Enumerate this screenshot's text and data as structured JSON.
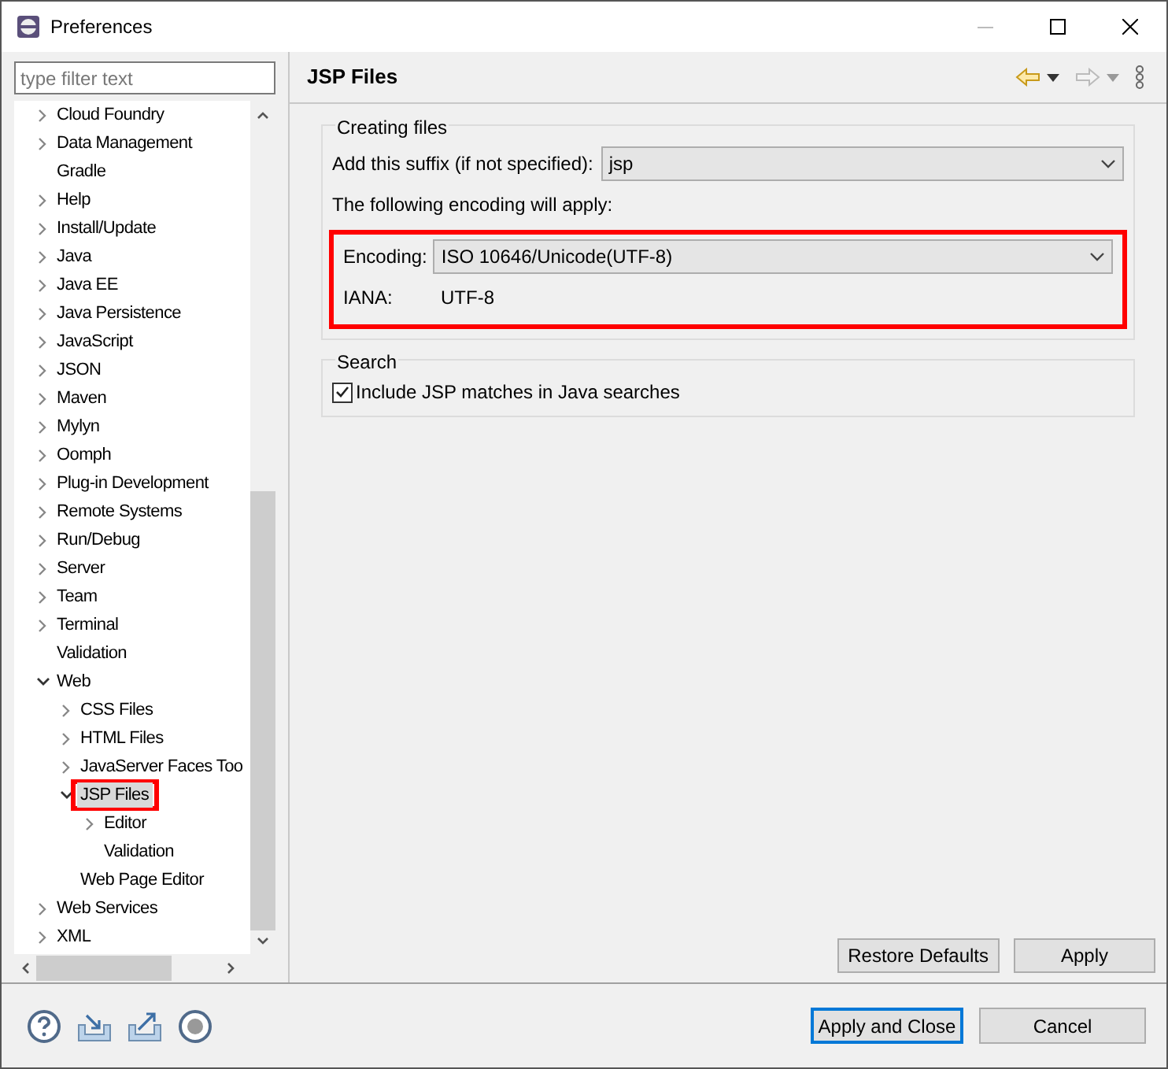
{
  "window": {
    "title": "Preferences"
  },
  "filter": {
    "placeholder": "type filter text"
  },
  "tree": [
    {
      "label": "Cloud Foundry",
      "kind": "branch",
      "expanded": false,
      "selected": false
    },
    {
      "label": "Data Management",
      "kind": "branch",
      "expanded": false,
      "selected": false
    },
    {
      "label": "Gradle",
      "kind": "leaf",
      "selected": false
    },
    {
      "label": "Help",
      "kind": "branch",
      "expanded": false,
      "selected": false
    },
    {
      "label": "Install/Update",
      "kind": "branch",
      "expanded": false,
      "selected": false
    },
    {
      "label": "Java",
      "kind": "branch",
      "expanded": false,
      "selected": false
    },
    {
      "label": "Java EE",
      "kind": "branch",
      "expanded": false,
      "selected": false
    },
    {
      "label": "Java Persistence",
      "kind": "branch",
      "expanded": false,
      "selected": false
    },
    {
      "label": "JavaScript",
      "kind": "branch",
      "expanded": false,
      "selected": false
    },
    {
      "label": "JSON",
      "kind": "branch",
      "expanded": false,
      "selected": false
    },
    {
      "label": "Maven",
      "kind": "branch",
      "expanded": false,
      "selected": false
    },
    {
      "label": "Mylyn",
      "kind": "branch",
      "expanded": false,
      "selected": false
    },
    {
      "label": "Oomph",
      "kind": "branch",
      "expanded": false,
      "selected": false
    },
    {
      "label": "Plug-in Development",
      "kind": "branch",
      "expanded": false,
      "selected": false
    },
    {
      "label": "Remote Systems",
      "kind": "branch",
      "expanded": false,
      "selected": false
    },
    {
      "label": "Run/Debug",
      "kind": "branch",
      "expanded": false,
      "selected": false
    },
    {
      "label": "Server",
      "kind": "branch",
      "expanded": false,
      "selected": false
    },
    {
      "label": "Team",
      "kind": "branch",
      "expanded": false,
      "selected": false
    },
    {
      "label": "Terminal",
      "kind": "branch",
      "expanded": false,
      "selected": false
    },
    {
      "label": "Validation",
      "kind": "leaf",
      "selected": false
    },
    {
      "label": "Web",
      "kind": "branch",
      "expanded": true,
      "selected": false,
      "children": [
        {
          "label": "CSS Files",
          "kind": "branch",
          "expanded": false,
          "selected": false
        },
        {
          "label": "HTML Files",
          "kind": "branch",
          "expanded": false,
          "selected": false
        },
        {
          "label": "JavaServer Faces Too",
          "kind": "branch",
          "expanded": false,
          "selected": false
        },
        {
          "label": "JSP Files",
          "kind": "branch",
          "expanded": true,
          "selected": true,
          "highlighted": true,
          "children": [
            {
              "label": "Editor",
              "kind": "branch",
              "expanded": false,
              "selected": false
            },
            {
              "label": "Validation",
              "kind": "leaf",
              "selected": false
            }
          ]
        },
        {
          "label": "Web Page Editor",
          "kind": "leaf",
          "selected": false
        }
      ]
    },
    {
      "label": "Web Services",
      "kind": "branch",
      "expanded": false,
      "selected": false
    },
    {
      "label": "XML",
      "kind": "branch",
      "expanded": false,
      "selected": false
    }
  ],
  "page": {
    "title": "JSP Files",
    "creating": {
      "legend": "Creating files",
      "suffix_label": "Add this suffix (if not specified):",
      "suffix_value": "jsp",
      "encoding_note": "The following encoding will apply:",
      "encoding_group": {
        "highlighted": true,
        "encoding_label": "Encoding:",
        "encoding_value": "ISO 10646/Unicode(UTF-8)",
        "iana_label": "IANA:",
        "iana_value": "UTF-8"
      }
    },
    "search": {
      "legend": "Search",
      "option": {
        "label": "Include JSP matches in Java searches",
        "checked": true
      }
    },
    "buttons": [
      "Restore Defaults",
      "Apply"
    ]
  },
  "footer_buttons": [
    {
      "label": "Apply and Close",
      "selected": true
    },
    {
      "label": "Cancel",
      "selected": false
    }
  ]
}
